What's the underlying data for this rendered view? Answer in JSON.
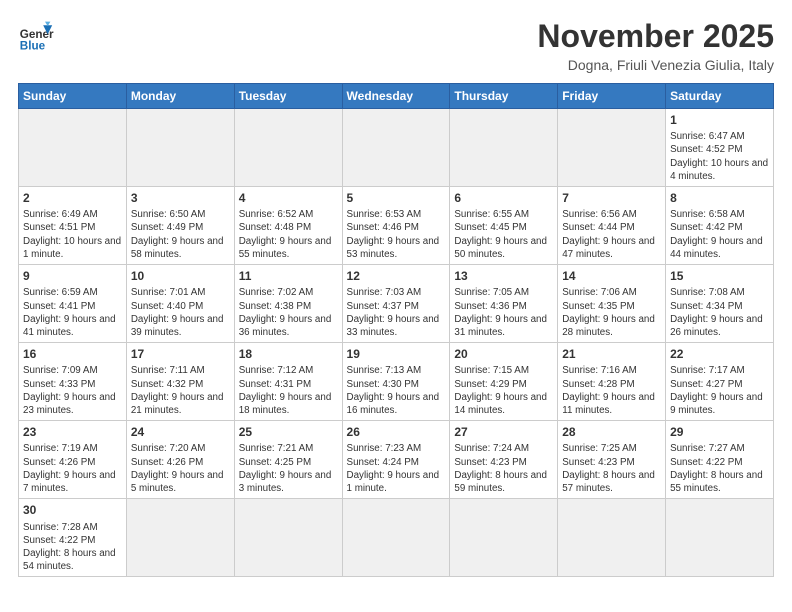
{
  "header": {
    "logo": {
      "line1": "General",
      "line2": "Blue"
    },
    "title": "November 2025",
    "subtitle": "Dogna, Friuli Venezia Giulia, Italy"
  },
  "weekdays": [
    "Sunday",
    "Monday",
    "Tuesday",
    "Wednesday",
    "Thursday",
    "Friday",
    "Saturday"
  ],
  "weeks": [
    [
      {
        "day": "",
        "info": "",
        "empty": true
      },
      {
        "day": "",
        "info": "",
        "empty": true
      },
      {
        "day": "",
        "info": "",
        "empty": true
      },
      {
        "day": "",
        "info": "",
        "empty": true
      },
      {
        "day": "",
        "info": "",
        "empty": true
      },
      {
        "day": "",
        "info": "",
        "empty": true
      },
      {
        "day": "1",
        "info": "Sunrise: 6:47 AM\nSunset: 4:52 PM\nDaylight: 10 hours\nand 4 minutes."
      }
    ],
    [
      {
        "day": "2",
        "info": "Sunrise: 6:49 AM\nSunset: 4:51 PM\nDaylight: 10 hours\nand 1 minute."
      },
      {
        "day": "3",
        "info": "Sunrise: 6:50 AM\nSunset: 4:49 PM\nDaylight: 9 hours\nand 58 minutes."
      },
      {
        "day": "4",
        "info": "Sunrise: 6:52 AM\nSunset: 4:48 PM\nDaylight: 9 hours\nand 55 minutes."
      },
      {
        "day": "5",
        "info": "Sunrise: 6:53 AM\nSunset: 4:46 PM\nDaylight: 9 hours\nand 53 minutes."
      },
      {
        "day": "6",
        "info": "Sunrise: 6:55 AM\nSunset: 4:45 PM\nDaylight: 9 hours\nand 50 minutes."
      },
      {
        "day": "7",
        "info": "Sunrise: 6:56 AM\nSunset: 4:44 PM\nDaylight: 9 hours\nand 47 minutes."
      },
      {
        "day": "8",
        "info": "Sunrise: 6:58 AM\nSunset: 4:42 PM\nDaylight: 9 hours\nand 44 minutes."
      }
    ],
    [
      {
        "day": "9",
        "info": "Sunrise: 6:59 AM\nSunset: 4:41 PM\nDaylight: 9 hours\nand 41 minutes."
      },
      {
        "day": "10",
        "info": "Sunrise: 7:01 AM\nSunset: 4:40 PM\nDaylight: 9 hours\nand 39 minutes."
      },
      {
        "day": "11",
        "info": "Sunrise: 7:02 AM\nSunset: 4:38 PM\nDaylight: 9 hours\nand 36 minutes."
      },
      {
        "day": "12",
        "info": "Sunrise: 7:03 AM\nSunset: 4:37 PM\nDaylight: 9 hours\nand 33 minutes."
      },
      {
        "day": "13",
        "info": "Sunrise: 7:05 AM\nSunset: 4:36 PM\nDaylight: 9 hours\nand 31 minutes."
      },
      {
        "day": "14",
        "info": "Sunrise: 7:06 AM\nSunset: 4:35 PM\nDaylight: 9 hours\nand 28 minutes."
      },
      {
        "day": "15",
        "info": "Sunrise: 7:08 AM\nSunset: 4:34 PM\nDaylight: 9 hours\nand 26 minutes."
      }
    ],
    [
      {
        "day": "16",
        "info": "Sunrise: 7:09 AM\nSunset: 4:33 PM\nDaylight: 9 hours\nand 23 minutes."
      },
      {
        "day": "17",
        "info": "Sunrise: 7:11 AM\nSunset: 4:32 PM\nDaylight: 9 hours\nand 21 minutes."
      },
      {
        "day": "18",
        "info": "Sunrise: 7:12 AM\nSunset: 4:31 PM\nDaylight: 9 hours\nand 18 minutes."
      },
      {
        "day": "19",
        "info": "Sunrise: 7:13 AM\nSunset: 4:30 PM\nDaylight: 9 hours\nand 16 minutes."
      },
      {
        "day": "20",
        "info": "Sunrise: 7:15 AM\nSunset: 4:29 PM\nDaylight: 9 hours\nand 14 minutes."
      },
      {
        "day": "21",
        "info": "Sunrise: 7:16 AM\nSunset: 4:28 PM\nDaylight: 9 hours\nand 11 minutes."
      },
      {
        "day": "22",
        "info": "Sunrise: 7:17 AM\nSunset: 4:27 PM\nDaylight: 9 hours\nand 9 minutes."
      }
    ],
    [
      {
        "day": "23",
        "info": "Sunrise: 7:19 AM\nSunset: 4:26 PM\nDaylight: 9 hours\nand 7 minutes."
      },
      {
        "day": "24",
        "info": "Sunrise: 7:20 AM\nSunset: 4:26 PM\nDaylight: 9 hours\nand 5 minutes."
      },
      {
        "day": "25",
        "info": "Sunrise: 7:21 AM\nSunset: 4:25 PM\nDaylight: 9 hours\nand 3 minutes."
      },
      {
        "day": "26",
        "info": "Sunrise: 7:23 AM\nSunset: 4:24 PM\nDaylight: 9 hours\nand 1 minute."
      },
      {
        "day": "27",
        "info": "Sunrise: 7:24 AM\nSunset: 4:23 PM\nDaylight: 8 hours\nand 59 minutes."
      },
      {
        "day": "28",
        "info": "Sunrise: 7:25 AM\nSunset: 4:23 PM\nDaylight: 8 hours\nand 57 minutes."
      },
      {
        "day": "29",
        "info": "Sunrise: 7:27 AM\nSunset: 4:22 PM\nDaylight: 8 hours\nand 55 minutes."
      }
    ],
    [
      {
        "day": "30",
        "info": "Sunrise: 7:28 AM\nSunset: 4:22 PM\nDaylight: 8 hours\nand 54 minutes."
      },
      {
        "day": "",
        "info": "",
        "empty": true
      },
      {
        "day": "",
        "info": "",
        "empty": true
      },
      {
        "day": "",
        "info": "",
        "empty": true
      },
      {
        "day": "",
        "info": "",
        "empty": true
      },
      {
        "day": "",
        "info": "",
        "empty": true
      },
      {
        "day": "",
        "info": "",
        "empty": true
      }
    ]
  ]
}
